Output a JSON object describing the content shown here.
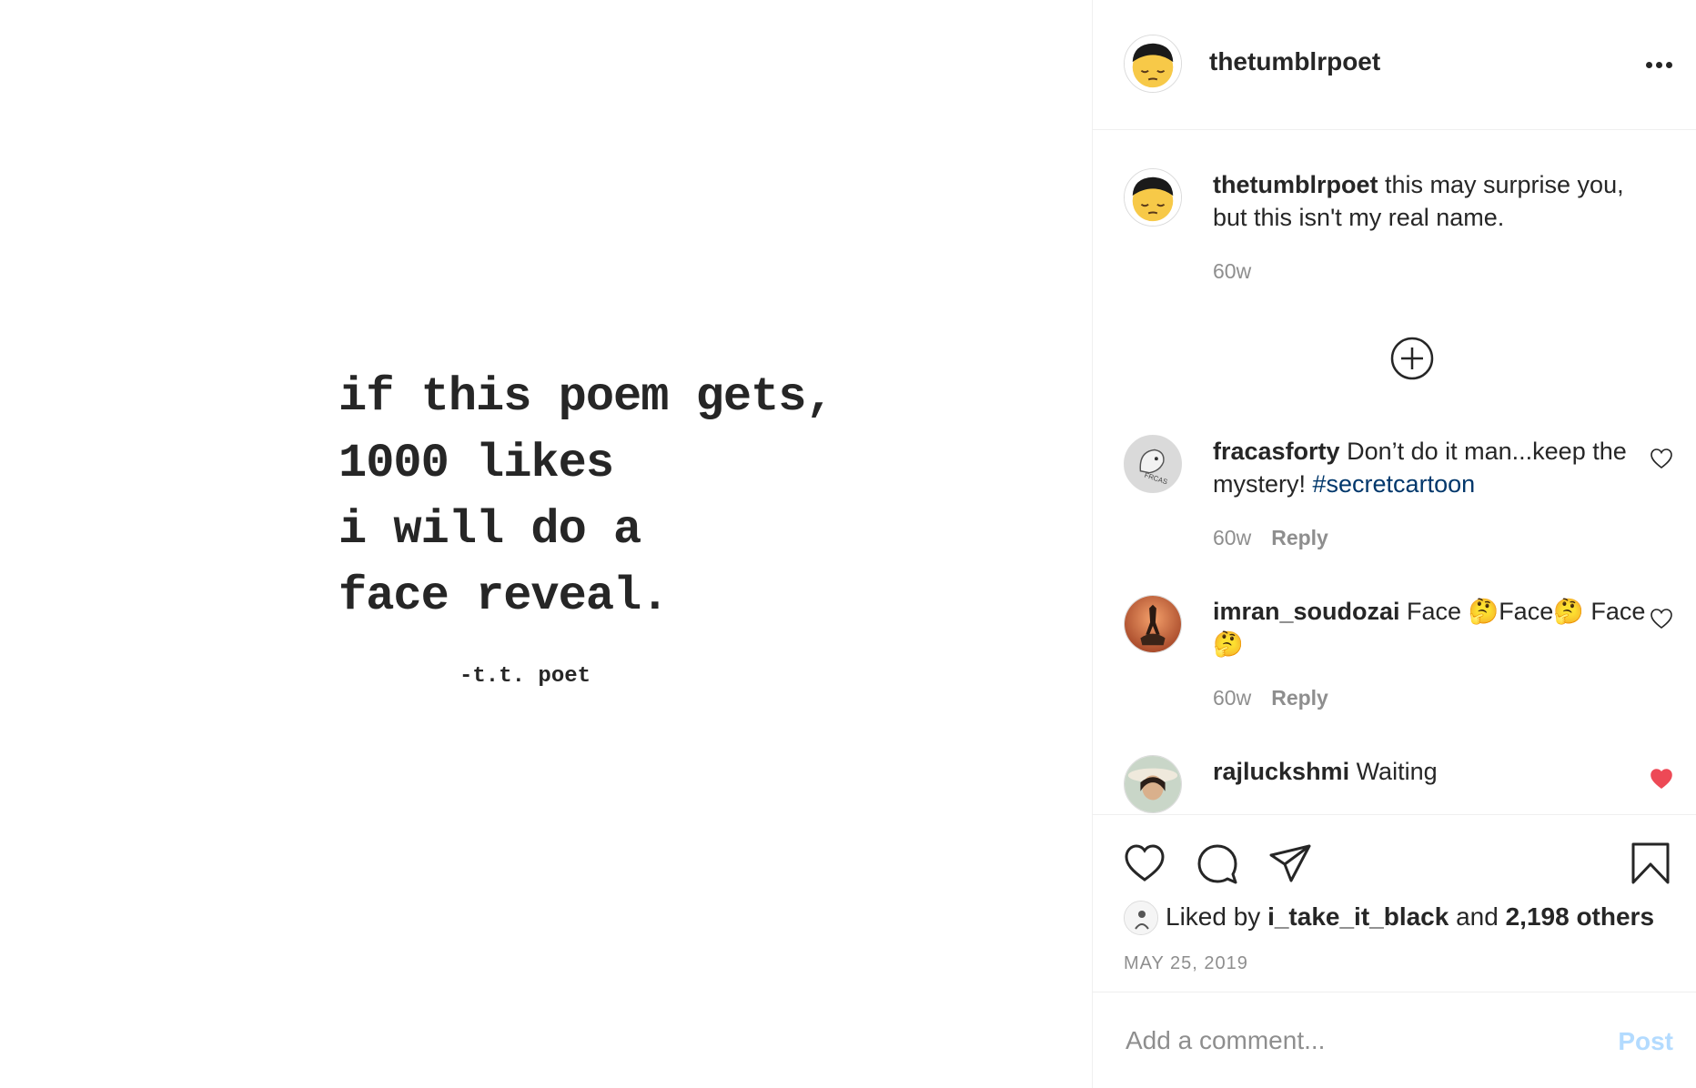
{
  "media": {
    "poem_lines": [
      "if this poem gets,",
      "1000 likes",
      "i will do a",
      "face reveal."
    ],
    "signature": "-t.t. poet"
  },
  "header": {
    "username": "thetumblrpoet",
    "more_icon": "more-horizontal-icon"
  },
  "caption": {
    "username": "thetumblrpoet",
    "text": " this may surprise you, but this isn't my real name.",
    "time": "60w"
  },
  "load_more_icon": "plus-circle-icon",
  "comments": [
    {
      "username": "fracasforty",
      "text": " Don’t do it man...keep the mystery! ",
      "hashtag": "#secretcartoon",
      "time": "60w",
      "reply": "Reply",
      "liked": false
    },
    {
      "username": "imran_soudozai",
      "text": " Face 🤔Face🤔 Face🤔",
      "time": "60w",
      "reply": "Reply",
      "liked": false
    },
    {
      "username": "rajluckshmi",
      "text": " Waiting",
      "liked": true
    }
  ],
  "actions": {
    "like_icon": "heart-icon",
    "comment_icon": "comment-icon",
    "share_icon": "paper-plane-icon",
    "save_icon": "bookmark-icon"
  },
  "likes": {
    "prefix": "Liked by ",
    "user": "i_take_it_black",
    "middle": " and ",
    "others": "2,198 others"
  },
  "date": "MAY 25, 2019",
  "add_comment": {
    "placeholder": "Add a comment...",
    "post_label": "Post"
  },
  "colors": {
    "text": "#262626",
    "secondary": "#8e8e8e",
    "hashtag": "#00376b",
    "liked_heart": "#ed4956",
    "post_disabled": "#b3dbff",
    "border": "#efefef"
  }
}
